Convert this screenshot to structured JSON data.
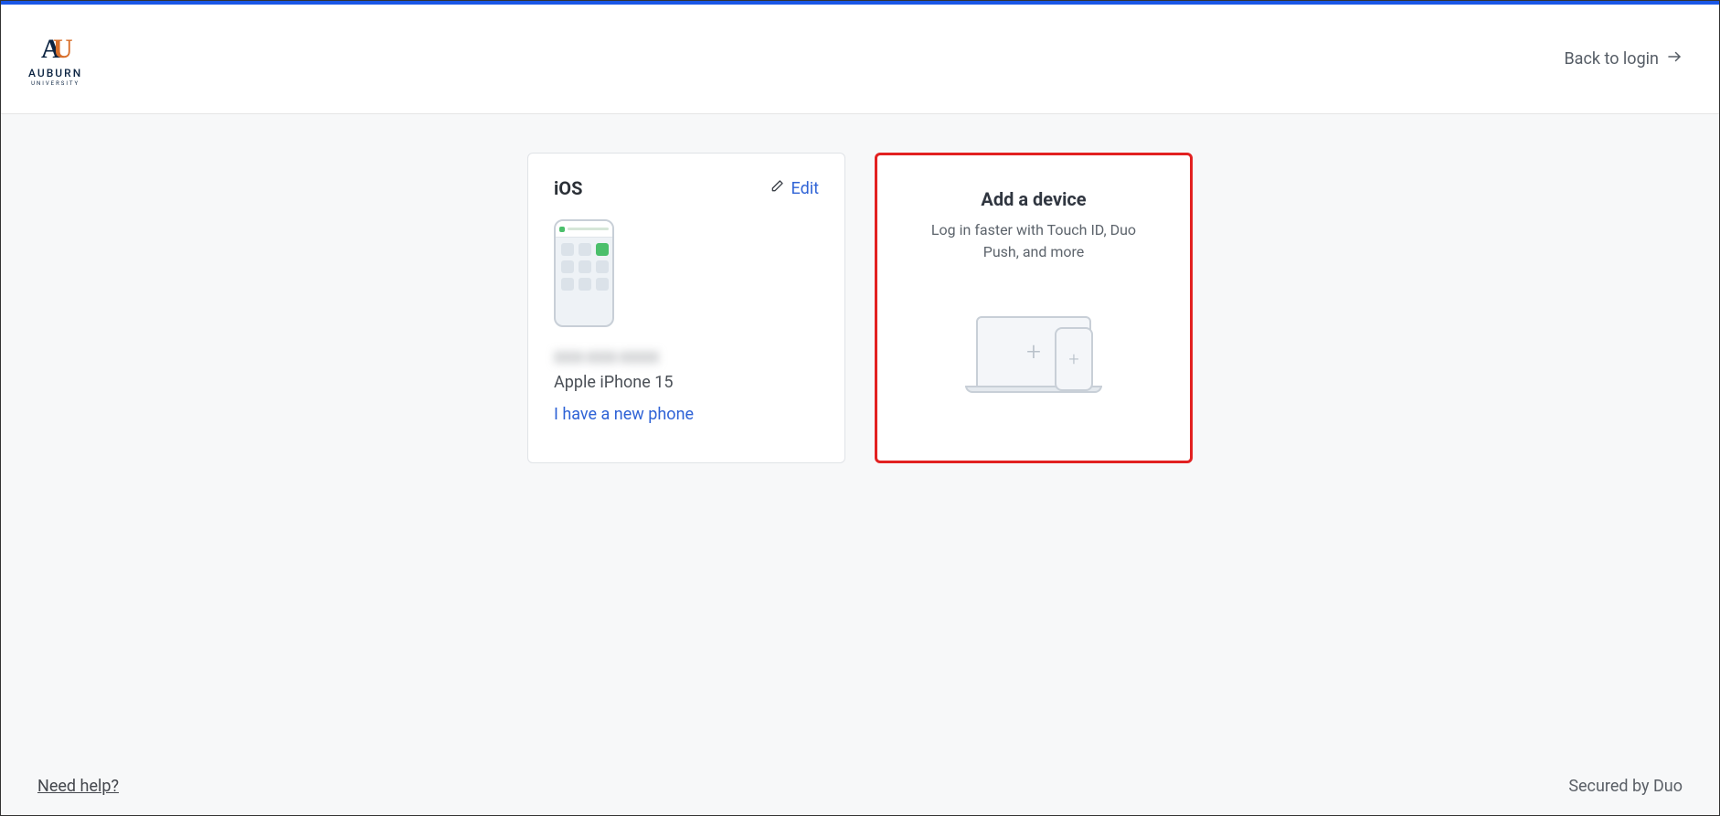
{
  "header": {
    "org_name": "AUBURN",
    "org_sub": "UNIVERSITY",
    "back_label": "Back to login"
  },
  "device_card": {
    "platform": "iOS",
    "edit_label": "Edit",
    "phone_number_masked": "XXX-XXX-XXXX",
    "model": "Apple iPhone 15",
    "new_phone_link": "I have a new phone"
  },
  "add_card": {
    "title": "Add a device",
    "subtitle": "Log in faster with Touch ID, Duo Push, and more"
  },
  "footer": {
    "help_label": "Need help?",
    "secured_label": "Secured by Duo"
  }
}
